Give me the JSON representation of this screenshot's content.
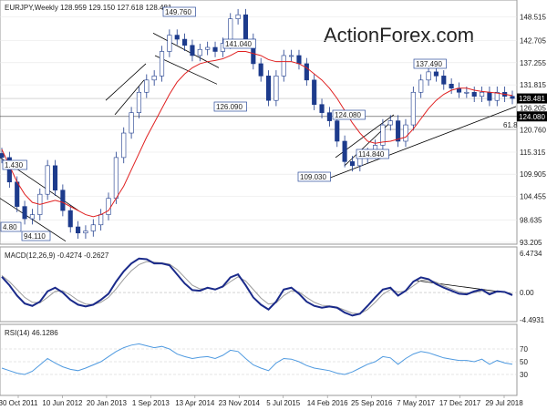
{
  "colors": {
    "candle": "#1d3b8c",
    "ma": "#e02020",
    "macd": "#1a2a8a",
    "signal": "#9a9a9a",
    "rsi": "#4f9ae0",
    "trend": "#000000",
    "grid": "#e6e6e6",
    "box_bg": "#000000",
    "box_fg": "#ffffff",
    "label_border": "#2a4a9a",
    "watermark": "#d8d8d8"
  },
  "chart_data": [
    {
      "type": "candlestick",
      "header": "EURJPY,Weekly  128.959 129.150 127.618 128.481",
      "watermark": "ActionForex.com",
      "ylim": [
        93.205,
        151.5
      ],
      "y_ticks": [
        "148.515",
        "142.705",
        "137.255",
        "131.815",
        "126.205",
        "120.760",
        "115.315",
        "109.905",
        "104.455",
        "98.635",
        "93.205"
      ],
      "x_ticks": [
        "30 Oct 2011",
        "10 Jun 2012",
        "20 Jan 2013",
        "1 Sep 2013",
        "13 Apr 2014",
        "23 Nov 2014",
        "5 Jul 2015",
        "14 Feb 2016",
        "25 Sep 2016",
        "7 May 2017",
        "17 Dec 2017",
        "29 Jul 2018"
      ],
      "price_boxes": [
        {
          "label": "128.481",
          "value": 128.481
        },
        {
          "label": "124.080",
          "value": 124.08
        }
      ],
      "retracement": {
        "label": "61.8",
        "value": 120.9
      },
      "annotations": [
        {
          "text": "1.430",
          "value": 111.43
        },
        {
          "text": "4.80",
          "value": 95.0
        },
        {
          "text": "94.110",
          "value": 94.11
        },
        {
          "text": "149.760",
          "value": 149.76
        },
        {
          "text": "141.040",
          "value": 141.04
        },
        {
          "text": "126.090",
          "value": 126.09
        },
        {
          "text": "124.080",
          "value": 124.08
        },
        {
          "text": "114.840",
          "value": 114.84
        },
        {
          "text": "109.030",
          "value": 109.03
        },
        {
          "text": "137.490",
          "value": 137.49
        }
      ],
      "series": [
        {
          "name": "",
          "kind": "candles",
          "close": [
            114.0,
            108.0,
            102.0,
            99.0,
            100.0,
            105.0,
            112.0,
            106.0,
            101.0,
            97.0,
            95.5,
            96.0,
            97.5,
            100.0,
            104.0,
            114.0,
            120.0,
            125.0,
            130.0,
            133.0,
            134.0,
            140.0,
            144.0,
            143.0,
            141.5,
            139.0,
            140.5,
            141.0,
            140.0,
            142.0,
            148.0,
            149.0,
            143.0,
            137.0,
            134.0,
            128.0,
            134.0,
            139.0,
            139.0,
            137.0,
            133.0,
            127.0,
            125.0,
            123.0,
            118.0,
            113.0,
            112.0,
            114.0,
            115.0,
            117.0,
            122.0,
            123.0,
            118.0,
            122.0,
            130.0,
            133.0,
            135.0,
            134.0,
            132.0,
            131.0,
            130.0,
            130.0,
            129.0,
            130.0,
            128.0,
            130.0,
            129.0,
            128.481
          ]
        },
        {
          "name": "",
          "kind": "moving-average",
          "values": [
            116.0,
            112.0,
            108.0,
            105.0,
            103.0,
            102.5,
            103.0,
            103.5,
            103.0,
            102.0,
            101.0,
            100.0,
            99.5,
            100.0,
            101.0,
            104.0,
            107.0,
            111.0,
            115.0,
            119.0,
            122.5,
            126.0,
            129.5,
            132.5,
            134.5,
            136.0,
            137.0,
            137.5,
            137.8,
            138.2,
            139.0,
            140.0,
            140.0,
            139.5,
            139.0,
            138.0,
            137.5,
            137.5,
            137.5,
            137.0,
            136.0,
            134.5,
            133.0,
            131.0,
            128.5,
            125.5,
            122.5,
            120.0,
            118.0,
            117.5,
            117.8,
            118.0,
            118.5,
            119.0,
            121.0,
            123.5,
            126.0,
            128.0,
            129.5,
            130.5,
            131.0,
            131.0,
            130.5,
            130.2,
            130.0,
            129.8,
            129.5,
            129.2
          ]
        }
      ],
      "trendlines": "drawn"
    },
    {
      "type": "line",
      "header": "MACD(12,26,9) -0.4274 -0.2627",
      "ylim": [
        -4.4931,
        6.4734
      ],
      "y_ticks": [
        "6.4734",
        "0.00",
        "-4.4931"
      ],
      "series": [
        {
          "name": "",
          "kind": "macd",
          "values": [
            2.6,
            1.2,
            -0.5,
            -1.8,
            -2.2,
            -1.5,
            0.2,
            0.8,
            0.0,
            -1.2,
            -2.0,
            -2.3,
            -2.0,
            -1.2,
            -0.2,
            1.8,
            3.5,
            4.8,
            5.6,
            5.5,
            4.8,
            4.8,
            4.5,
            3.0,
            1.5,
            0.4,
            0.3,
            0.8,
            0.5,
            1.0,
            2.5,
            3.0,
            1.2,
            -0.8,
            -2.0,
            -2.8,
            -1.5,
            0.5,
            0.8,
            -0.2,
            -1.5,
            -2.2,
            -2.5,
            -2.3,
            -2.5,
            -3.3,
            -3.8,
            -3.5,
            -2.2,
            -0.8,
            0.5,
            0.8,
            -0.5,
            0.3,
            1.8,
            2.5,
            2.2,
            1.4,
            0.8,
            0.3,
            -0.2,
            -0.3,
            0.2,
            0.5,
            -0.3,
            0.2,
            0.1,
            -0.43
          ]
        },
        {
          "name": "",
          "kind": "signal",
          "values": [
            2.8,
            1.8,
            0.5,
            -0.8,
            -1.6,
            -1.7,
            -0.8,
            0.2,
            0.3,
            -0.4,
            -1.3,
            -1.9,
            -2.0,
            -1.6,
            -0.8,
            0.6,
            2.2,
            3.6,
            4.6,
            5.1,
            5.0,
            4.9,
            4.7,
            3.8,
            2.5,
            1.2,
            0.6,
            0.7,
            0.6,
            0.9,
            1.8,
            2.6,
            1.9,
            0.5,
            -0.9,
            -1.9,
            -1.7,
            -0.5,
            0.3,
            0.1,
            -0.8,
            -1.6,
            -2.1,
            -2.2,
            -2.4,
            -2.9,
            -3.4,
            -3.5,
            -2.8,
            -1.6,
            -0.3,
            0.5,
            0.1,
            0.2,
            1.1,
            2.0,
            2.1,
            1.7,
            1.1,
            0.6,
            0.1,
            -0.1,
            0.0,
            0.3,
            0.0,
            0.1,
            0.1,
            -0.26
          ]
        }
      ]
    },
    {
      "type": "line",
      "header": "RSI(14) 46.1286",
      "ylim": [
        0,
        100
      ],
      "y_ticks": [
        "70",
        "50",
        "30"
      ],
      "series": [
        {
          "name": "",
          "kind": "rsi",
          "values": [
            40,
            36,
            32,
            30,
            35,
            45,
            55,
            48,
            42,
            38,
            36,
            40,
            45,
            50,
            58,
            66,
            72,
            76,
            78,
            75,
            72,
            74,
            70,
            62,
            58,
            55,
            57,
            58,
            55,
            60,
            68,
            66,
            55,
            45,
            40,
            36,
            48,
            55,
            54,
            50,
            44,
            40,
            38,
            36,
            32,
            30,
            34,
            40,
            46,
            50,
            58,
            56,
            46,
            55,
            62,
            66,
            64,
            60,
            56,
            54,
            52,
            52,
            50,
            54,
            46,
            52,
            48,
            46
          ]
        }
      ]
    }
  ]
}
